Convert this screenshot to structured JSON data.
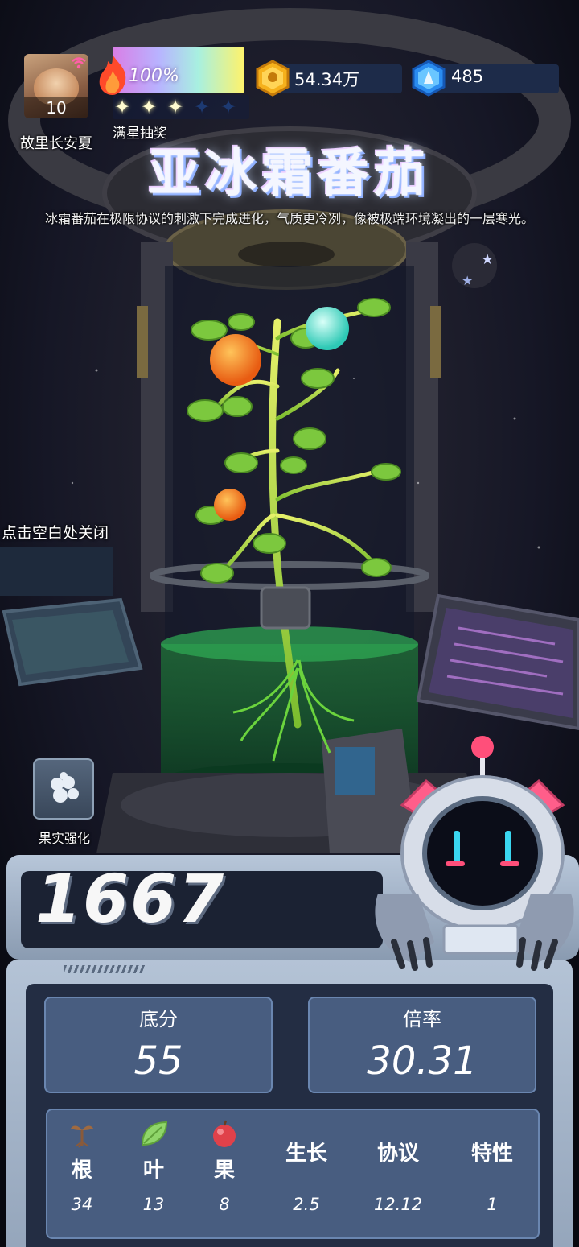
{
  "player": {
    "name": "故里长安夏",
    "level": "10"
  },
  "energy": {
    "percent_text": "100%",
    "stars_filled": 3,
    "stars_total": 5,
    "star_label": "满星抽奖"
  },
  "resources": {
    "gold": "54.34万",
    "gems": "485"
  },
  "plant": {
    "title": "亚冰霜番茄",
    "description": "冰霜番茄在极限协议的刺激下完成进化，气质更冷冽，像被极端环境凝出的一层寒光。"
  },
  "hints": {
    "close": "点击空白处关闭",
    "fruit_enhance": "果实强化"
  },
  "score": {
    "total": "1667",
    "base_label": "底分",
    "base_value": "55",
    "mult_label": "倍率",
    "mult_value": "30.31"
  },
  "stats": [
    {
      "label": "根",
      "value": "34",
      "icon": "sprout-root-icon"
    },
    {
      "label": "叶",
      "value": "13",
      "icon": "leaf-icon"
    },
    {
      "label": "果",
      "value": "8",
      "icon": "apple-icon"
    },
    {
      "label": "生长",
      "value": "2.5"
    },
    {
      "label": "协议",
      "value": "12.12"
    },
    {
      "label": "特性",
      "value": "1"
    }
  ],
  "colors": {
    "panel_frame": "#b4c3d6",
    "panel_inner": "#232d43",
    "stat_box": "#485d80",
    "energy_gradient_start": "#d97ee6",
    "energy_gradient_end": "#fff36b"
  }
}
